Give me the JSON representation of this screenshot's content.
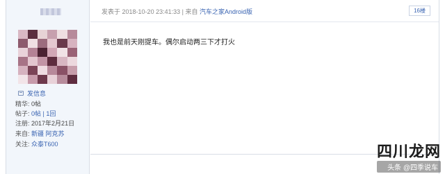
{
  "post": {
    "posted_prefix": "发表于",
    "timestamp": "2018-10-20 23:41:33",
    "separator": "|",
    "source_prefix": "来自",
    "source": "汽车之家Android版",
    "floor": "16楼",
    "content": "我也是前天刚提车。偶尔启动两三下才打火"
  },
  "user": {
    "send_message": "发信息",
    "stats": [
      {
        "key": "精华:",
        "value": "0帖"
      },
      {
        "key": "帖子:",
        "value": "0帖 | 1回"
      },
      {
        "key": "注册:",
        "value": "2017年2月21日"
      },
      {
        "key": "来自:",
        "value": "新疆 阿克苏"
      },
      {
        "key": "关注:",
        "value": "众泰T600"
      }
    ]
  },
  "watermark": {
    "logo": "四川龙网",
    "line": "头条 @四季说车"
  }
}
